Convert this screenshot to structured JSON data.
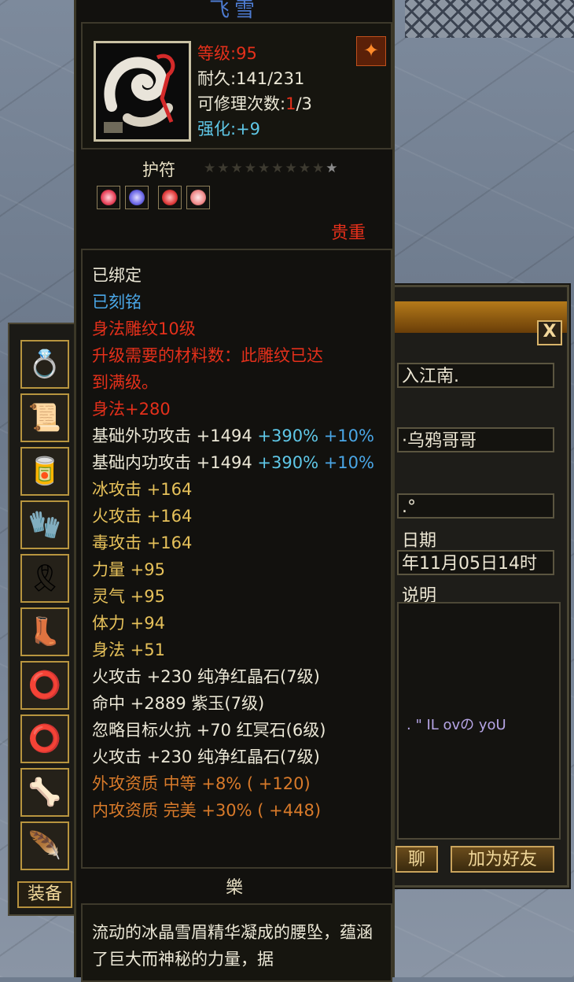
{
  "item": {
    "name": "飞雪",
    "level_label": "等级:",
    "level": "95",
    "durability": "耐久:141/231",
    "repair_label": "可修理次数:",
    "repair_used": "1",
    "repair_total": "/3",
    "enhance_label": "强化:",
    "enhance_value": "+9",
    "type": "护符",
    "stars_total": 10,
    "stars_lit": 1,
    "gems": [
      "#e8435a",
      "#6a66e6",
      "#e03a3a",
      "#f08a8a"
    ],
    "rarity": "贵重"
  },
  "attributes": [
    {
      "text": "已绑定",
      "color": "white"
    },
    {
      "text": "已刻铭",
      "color": "blue"
    },
    {
      "text": "身法雕纹10级",
      "color": "red"
    },
    {
      "text": "升级需要的材料数：此雕纹已达",
      "color": "red"
    },
    {
      "text": "到满级。",
      "color": "red"
    },
    {
      "text": "身法+280",
      "color": "red"
    },
    {
      "text": "基础外功攻击  +1494",
      "color": "white",
      "extra1": " +390%",
      "extra2": " +10%"
    },
    {
      "text": "基础内功攻击  +1494",
      "color": "white",
      "extra1": " +390%",
      "extra2": " +10%"
    },
    {
      "text": "冰攻击  +164",
      "color": "yellow"
    },
    {
      "text": "火攻击  +164",
      "color": "yellow"
    },
    {
      "text": "毒攻击  +164",
      "color": "yellow"
    },
    {
      "text": "力量  +95",
      "color": "yellow"
    },
    {
      "text": "灵气  +95",
      "color": "yellow"
    },
    {
      "text": "体力  +94",
      "color": "yellow"
    },
    {
      "text": "身法  +51",
      "color": "yellow"
    },
    {
      "text": "火攻击  +230  纯净红晶石(7级)",
      "color": "white"
    },
    {
      "text": "命中  +2889  紫玉(7级)",
      "color": "white"
    },
    {
      "text": "忽略目标火抗  +70  红冥石(6级)",
      "color": "white"
    },
    {
      "text": "火攻击  +230  纯净红晶石(7级)",
      "color": "white"
    },
    {
      "text": "外攻资质    中等  +8%  ( +120)",
      "color": "orange"
    },
    {
      "text": "内攻资质    完美  +30%  ( +448)",
      "color": "orange"
    }
  ],
  "description": {
    "title": "樂",
    "text": "流动的冰晶雪眉精华凝成的腰坠，蕴涵了巨大而神秘的力量，据"
  },
  "friend_window": {
    "field1": "入江南.",
    "field2": "·乌鸦哥哥",
    "field3": ".°",
    "date_label": "日期",
    "date_value": "年11月05日14时",
    "desc_label": "说明",
    "signature": ". \"  IL ovの yoU",
    "chat_button": "聊",
    "add_friend_button": "加为好友",
    "close_symbol": "X"
  },
  "equipment": {
    "tab_label": "装备",
    "slots": [
      "💍",
      "📜",
      "🥫",
      "🧤",
      "🎗",
      "👢",
      "⭕",
      "⭕",
      "🦴",
      "🪶"
    ]
  }
}
